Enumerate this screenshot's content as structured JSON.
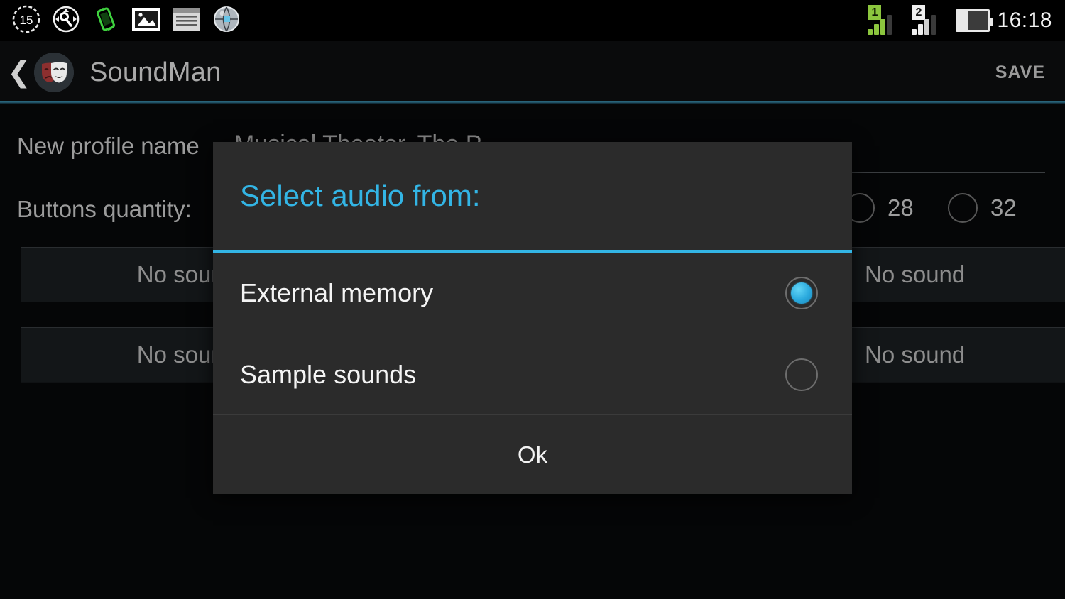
{
  "status_bar": {
    "icons": [
      {
        "name": "timer-15-icon",
        "label": "15"
      },
      {
        "name": "developer-wrench-icon",
        "label": ""
      },
      {
        "name": "rotate-device-icon",
        "label": ""
      },
      {
        "name": "gallery-image-icon",
        "label": ""
      },
      {
        "name": "notes-list-icon",
        "label": ""
      },
      {
        "name": "browser-globe-icon",
        "label": ""
      }
    ],
    "sim1_label": "1",
    "sim2_label": "2",
    "battery_name": "battery-icon",
    "clock": "16:18"
  },
  "action_bar": {
    "back_label": "❮",
    "app_icon_name": "theater-masks-icon",
    "title": "SoundMan",
    "save_label": "SAVE"
  },
  "background": {
    "profile_label": "New profile name",
    "profile_value": "Musical Theater. The P",
    "quantity_label": "Buttons quantity:",
    "quantity_options": [
      {
        "value": "28",
        "selected": false
      },
      {
        "value": "32",
        "selected": false
      }
    ],
    "sound_buttons": [
      {
        "label": "No sound"
      },
      {
        "label": "No sound"
      },
      {
        "label": "No sound"
      },
      {
        "label": "No sound"
      }
    ]
  },
  "dialog": {
    "title": "Select audio from:",
    "accent_color": "#33b5e5",
    "options": [
      {
        "label": "External memory",
        "selected": true
      },
      {
        "label": "Sample sounds",
        "selected": false
      }
    ],
    "ok_label": "Ok"
  }
}
